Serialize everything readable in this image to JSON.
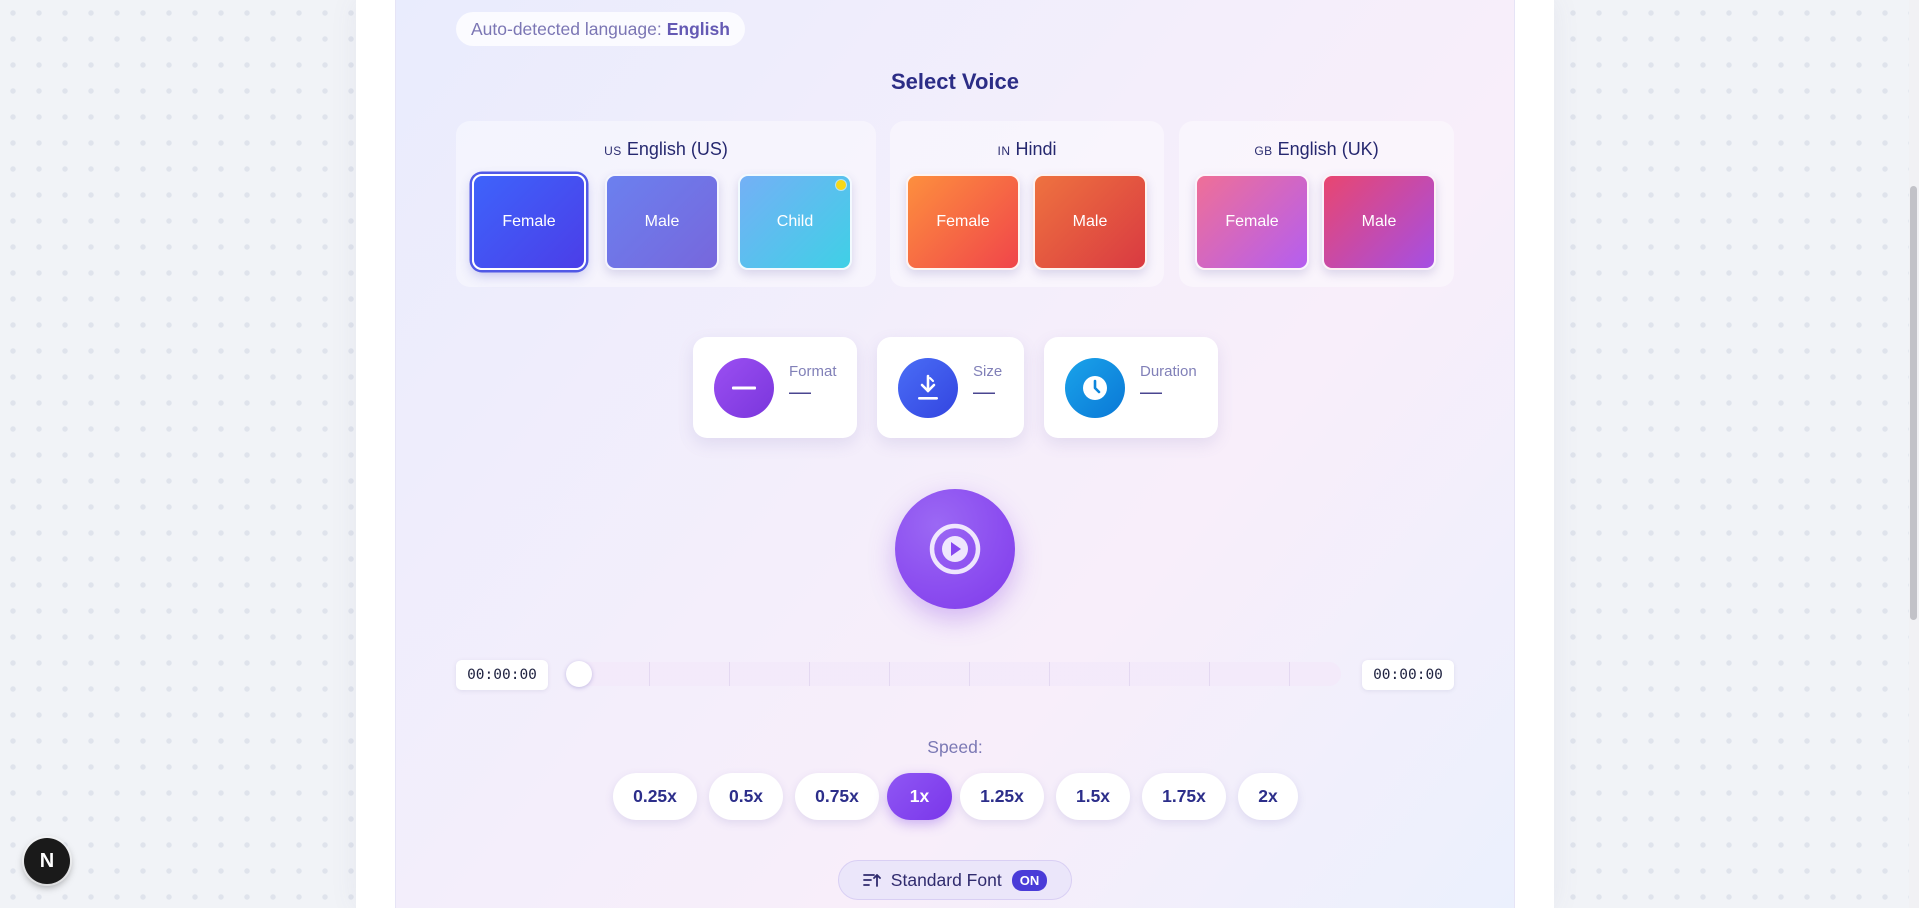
{
  "language_detection": {
    "prefix": "Auto-detected language:",
    "value": "English"
  },
  "voice_section": {
    "title": "Select Voice",
    "groups": [
      {
        "code": "US",
        "name": "English (US)",
        "voices": [
          {
            "label": "Female",
            "selected": true
          },
          {
            "label": "Male"
          },
          {
            "label": "Child",
            "badge": "new-dot"
          }
        ]
      },
      {
        "code": "IN",
        "name": "Hindi",
        "voices": [
          {
            "label": "Female"
          },
          {
            "label": "Male"
          }
        ]
      },
      {
        "code": "GB",
        "name": "English (UK)",
        "voices": [
          {
            "label": "Female"
          },
          {
            "label": "Male"
          }
        ]
      }
    ]
  },
  "audio_info": [
    {
      "label": "Format",
      "value": "—",
      "icon": "dash-icon",
      "color": "#8a46ec"
    },
    {
      "label": "Size",
      "value": "—",
      "icon": "download-icon",
      "color": "#3e5cf0"
    },
    {
      "label": "Duration",
      "value": "—",
      "icon": "clock-icon",
      "color": "#0d8ee0"
    }
  ],
  "player": {
    "play_icon": "play-circle-icon",
    "current_time": "00:00:00",
    "total_time": "00:00:00",
    "progress": 0
  },
  "speed": {
    "label": "Speed:",
    "options": [
      "0.25x",
      "0.5x",
      "0.75x",
      "1x",
      "1.25x",
      "1.5x",
      "1.75x",
      "2x"
    ],
    "selected": "1x"
  },
  "font_toggle": {
    "icon": "text-size-icon",
    "label": "Standard Font",
    "state": "ON"
  },
  "dev_badge": {
    "letter": "N"
  },
  "colors": {
    "accent": "#8a4cf0",
    "title": "#2c2d86",
    "us_female": "#3d5af5",
    "us_male": "#6b74ec",
    "us_child": "#62c0f3",
    "in_female": "#fb7e45",
    "in_male": "#e8573f",
    "gb_female": "#d974c8",
    "gb_male": "#d65691"
  }
}
